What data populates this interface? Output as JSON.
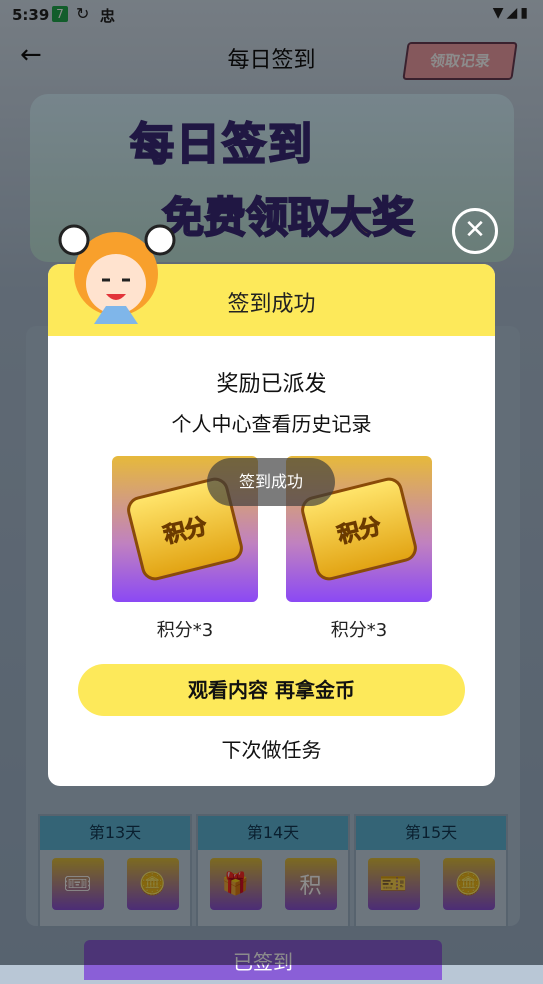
{
  "status_bar": {
    "time": "5:39",
    "badge": "7",
    "char": "忠",
    "right_icons": "▼◢▮"
  },
  "header": {
    "title": "每日签到",
    "back_glyph": "←",
    "records_label": "领取记录"
  },
  "banner": {
    "line1": "每日签到",
    "line2": "免费领取大奖"
  },
  "days": [
    {
      "label": "第13天",
      "icons": [
        "🎟",
        "🪙"
      ]
    },
    {
      "label": "第14天",
      "icons": [
        "🎁",
        "积"
      ]
    },
    {
      "label": "第15天",
      "icons": [
        "🎫",
        "🪙"
      ]
    }
  ],
  "signed_button": "已签到",
  "modal": {
    "title": "签到成功",
    "line1": "奖励已派发",
    "line2": "个人中心查看历史记录",
    "reward_icon_text": "积分",
    "rewards": [
      {
        "label": "积分*3"
      },
      {
        "label": "积分*3"
      }
    ],
    "toast": "签到成功",
    "watch_button": "观看内容 再拿金币",
    "next_button": "下次做任务",
    "close_glyph": "✕"
  }
}
